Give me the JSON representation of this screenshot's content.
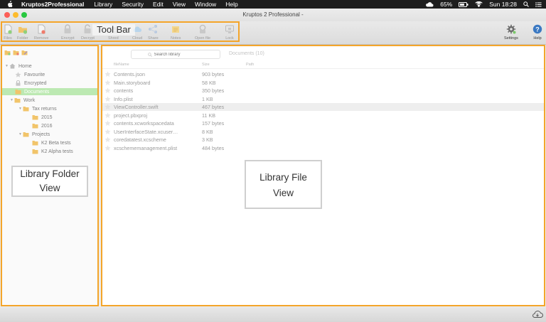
{
  "menubar": {
    "app_name": "Kruptos2Professional",
    "items": [
      "Library",
      "Security",
      "Edit",
      "View",
      "Window",
      "Help"
    ],
    "battery": "65%",
    "clock": "Sun 18:28"
  },
  "window": {
    "title": "Kruptos 2 Professional -"
  },
  "toolbar": {
    "callout": "Tool Bar",
    "buttons": [
      {
        "label": "Files",
        "icon": "add-file-icon"
      },
      {
        "label": "Folder",
        "icon": "add-folder-icon"
      },
      {
        "label": "Remove",
        "icon": "remove-icon"
      },
      {
        "label": "Encrypt",
        "icon": "lock-icon"
      },
      {
        "label": "Decrypt",
        "icon": "unlock-icon"
      },
      {
        "label": "Shred",
        "icon": "shred-icon"
      },
      {
        "label": "Cloud",
        "icon": "cloud-icon"
      },
      {
        "label": "Share",
        "icon": "share-icon"
      },
      {
        "label": "Notes",
        "icon": "notes-icon"
      },
      {
        "label": "Open file",
        "icon": "open-file-icon"
      },
      {
        "label": "Lock",
        "icon": "lock-screen-icon"
      },
      {
        "label": "Settings",
        "icon": "gear-icon"
      },
      {
        "label": "Help",
        "icon": "help-icon"
      }
    ]
  },
  "sidebar": {
    "callout_line1": "Library Folder",
    "callout_line2": "View",
    "items": [
      {
        "label": "Home"
      },
      {
        "label": "Favourite"
      },
      {
        "label": "Encrypted"
      },
      {
        "label": "Documents"
      },
      {
        "label": "Work"
      },
      {
        "label": "Tax returns"
      },
      {
        "label": "2015"
      },
      {
        "label": "2016"
      },
      {
        "label": "Projects"
      },
      {
        "label": "K2 Beta tests"
      },
      {
        "label": "K2 Alpha tests"
      }
    ]
  },
  "main": {
    "search_placeholder": "Search library",
    "title": "Documents (10)",
    "columns": [
      "fileName",
      "Size",
      "Path"
    ],
    "callout_line1": "Library File",
    "callout_line2": "View",
    "files": [
      {
        "name": "Contents.json",
        "size": "903 bytes"
      },
      {
        "name": "Main.storyboard",
        "size": "58 KB"
      },
      {
        "name": "contents",
        "size": "350 bytes"
      },
      {
        "name": "Info.plist",
        "size": "1 KB"
      },
      {
        "name": "ViewController.swift",
        "size": "467 bytes"
      },
      {
        "name": "project.pbxproj",
        "size": "11 KB"
      },
      {
        "name": "contents.xcworkspacedata",
        "size": "157 bytes"
      },
      {
        "name": "UserInterfaceState.xcuser…",
        "size": "8 KB"
      },
      {
        "name": "coredatatest.xcscheme",
        "size": "3 KB"
      },
      {
        "name": "xcschememanagement.plist",
        "size": "484 bytes"
      }
    ]
  },
  "colors": {
    "highlight": "#f4a52a",
    "selection": "#bce9b2",
    "folder": "#f1c46a"
  }
}
